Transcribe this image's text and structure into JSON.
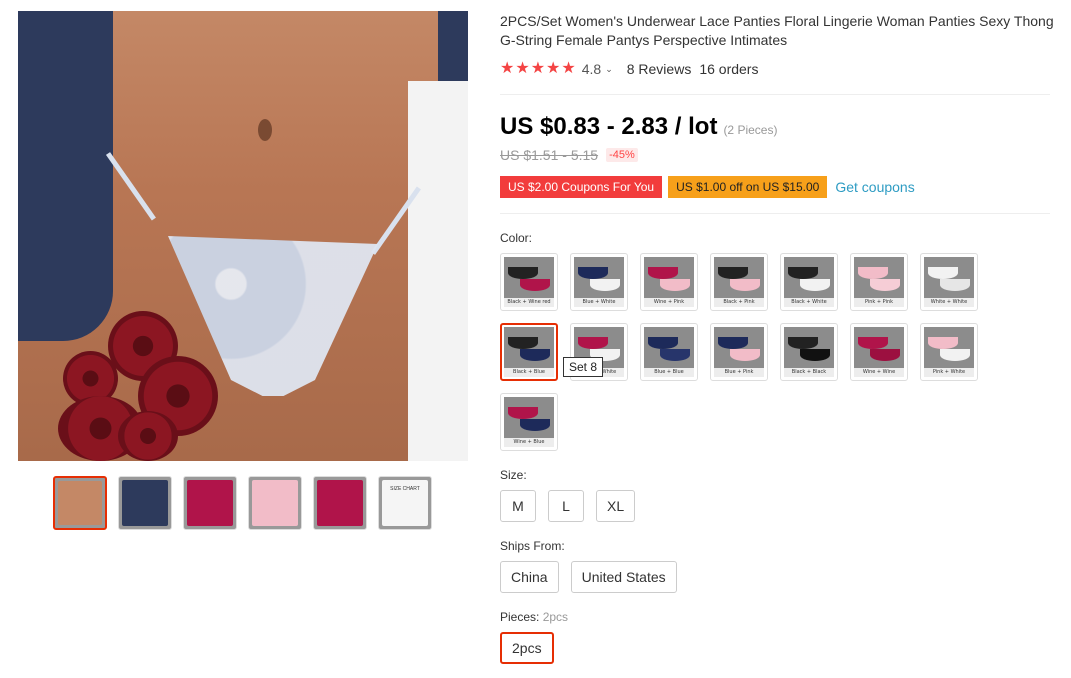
{
  "product": {
    "title": "2PCS/Set Women's Underwear Lace Panties Floral Lingerie Woman Panties Sexy Thong G-String Female Pantys Perspective Intimates",
    "rating": "4.8",
    "rating_stars": 5,
    "reviews": "8 Reviews",
    "orders": "16 orders"
  },
  "price": {
    "main": "US $0.83 - 2.83 / lot",
    "unit_note": "(2 Pieces)",
    "original": "US $1.51 - 5.15",
    "discount": "-45%"
  },
  "coupons": {
    "items": [
      "US $2.00 Coupons For You",
      "US $1.00 off on US $15.00"
    ],
    "get_label": "Get coupons"
  },
  "color": {
    "label": "Color:",
    "selected_index": 7,
    "tooltip": "Set 8",
    "options": [
      {
        "caption": "Black + Wine red",
        "c1": "#222222",
        "c2": "#b0144a"
      },
      {
        "caption": "Blue + White",
        "c1": "#1d2a5a",
        "c2": "#f2f2f2"
      },
      {
        "caption": "Wine + Pink",
        "c1": "#b0144a",
        "c2": "#f2bcc8"
      },
      {
        "caption": "Black + Pink",
        "c1": "#222222",
        "c2": "#f2bcc8"
      },
      {
        "caption": "Black + White",
        "c1": "#222222",
        "c2": "#f2f2f2"
      },
      {
        "caption": "Pink + Pink",
        "c1": "#f2bcc8",
        "c2": "#f6cdd6"
      },
      {
        "caption": "White + White",
        "c1": "#f2f2f2",
        "c2": "#e6e6e6"
      },
      {
        "caption": "Black + Blue",
        "c1": "#222222",
        "c2": "#1d2a5a"
      },
      {
        "caption": "Wine + White",
        "c1": "#b0144a",
        "c2": "#f2f2f2"
      },
      {
        "caption": "Blue + Blue",
        "c1": "#1d2a5a",
        "c2": "#27356b"
      },
      {
        "caption": "Blue + Pink",
        "c1": "#1d2a5a",
        "c2": "#f2bcc8"
      },
      {
        "caption": "Black + Black",
        "c1": "#222222",
        "c2": "#111111"
      },
      {
        "caption": "Wine + Wine",
        "c1": "#b0144a",
        "c2": "#9c1040"
      },
      {
        "caption": "Pink + White",
        "c1": "#f2bcc8",
        "c2": "#f2f2f2"
      },
      {
        "caption": "Wine + Blue",
        "c1": "#b0144a",
        "c2": "#1d2a5a"
      }
    ]
  },
  "size": {
    "label": "Size:",
    "options": [
      "M",
      "L",
      "XL"
    ]
  },
  "ships_from": {
    "label": "Ships From:",
    "options": [
      "China",
      "United States"
    ]
  },
  "pieces": {
    "label": "Pieces:",
    "selected_value": "2pcs",
    "options": [
      "2pcs"
    ]
  },
  "gallery": {
    "thumbs": [
      {
        "name": "thumb-1",
        "color": "#c48866"
      },
      {
        "name": "thumb-2",
        "color": "#2d3a5c"
      },
      {
        "name": "thumb-3",
        "color": "#b0144a"
      },
      {
        "name": "thumb-4",
        "color": "#f2bcc8"
      },
      {
        "name": "thumb-5",
        "color": "#b0144a"
      },
      {
        "name": "thumb-6",
        "color": "#f5f5f5"
      }
    ],
    "size_chart_label": "SIZE CHART"
  },
  "colors": {
    "accent": "#e62e04",
    "star": "#f44444",
    "link": "#2e9cc3"
  }
}
